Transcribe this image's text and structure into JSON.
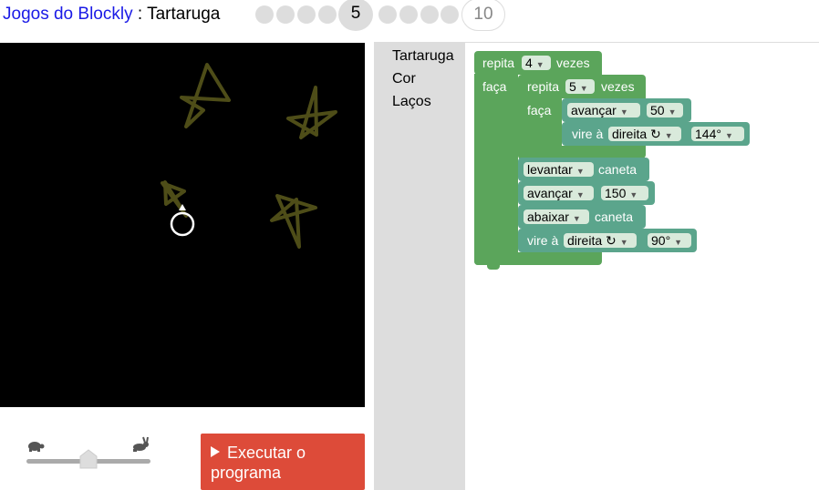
{
  "header": {
    "app_name": "Jogos do Blockly",
    "separator": " : ",
    "game_name": "Tartaruga",
    "current_level": "5",
    "max_level": "10"
  },
  "toolbox": {
    "categories": [
      "Tartaruga",
      "Cor",
      "Laços"
    ]
  },
  "run_button": {
    "label": "Executar o programa"
  },
  "colors": {
    "loop_block": "#5ba55b",
    "turtle_block": "#5ba58c",
    "run_button": "#dd4b39",
    "stars": "#4e4d18",
    "turtle_outline": "#ffffff"
  },
  "blocks": {
    "outer_repeat": {
      "label": "repita",
      "count": "4",
      "suffix": "vezes",
      "do_label": "faça"
    },
    "inner_repeat": {
      "label": "repita",
      "count": "5",
      "suffix": "vezes",
      "do_label": "faça"
    },
    "move1": {
      "label": "avançar",
      "value": "50"
    },
    "turn1": {
      "label": "vire à",
      "direction": "direita ↻",
      "angle": "144°"
    },
    "pen_up": {
      "label": "levantar",
      "suffix": "caneta"
    },
    "move2": {
      "label": "avançar",
      "value": "150"
    },
    "pen_down": {
      "label": "abaixar",
      "suffix": "caneta"
    },
    "turn2": {
      "label": "vire à",
      "direction": "direita ↻",
      "angle": "90°"
    }
  },
  "icons": {
    "speed_slow": "turtle-icon",
    "speed_fast": "rabbit-icon",
    "run": "play-icon",
    "dropdown": "dropdown-arrow-icon"
  }
}
